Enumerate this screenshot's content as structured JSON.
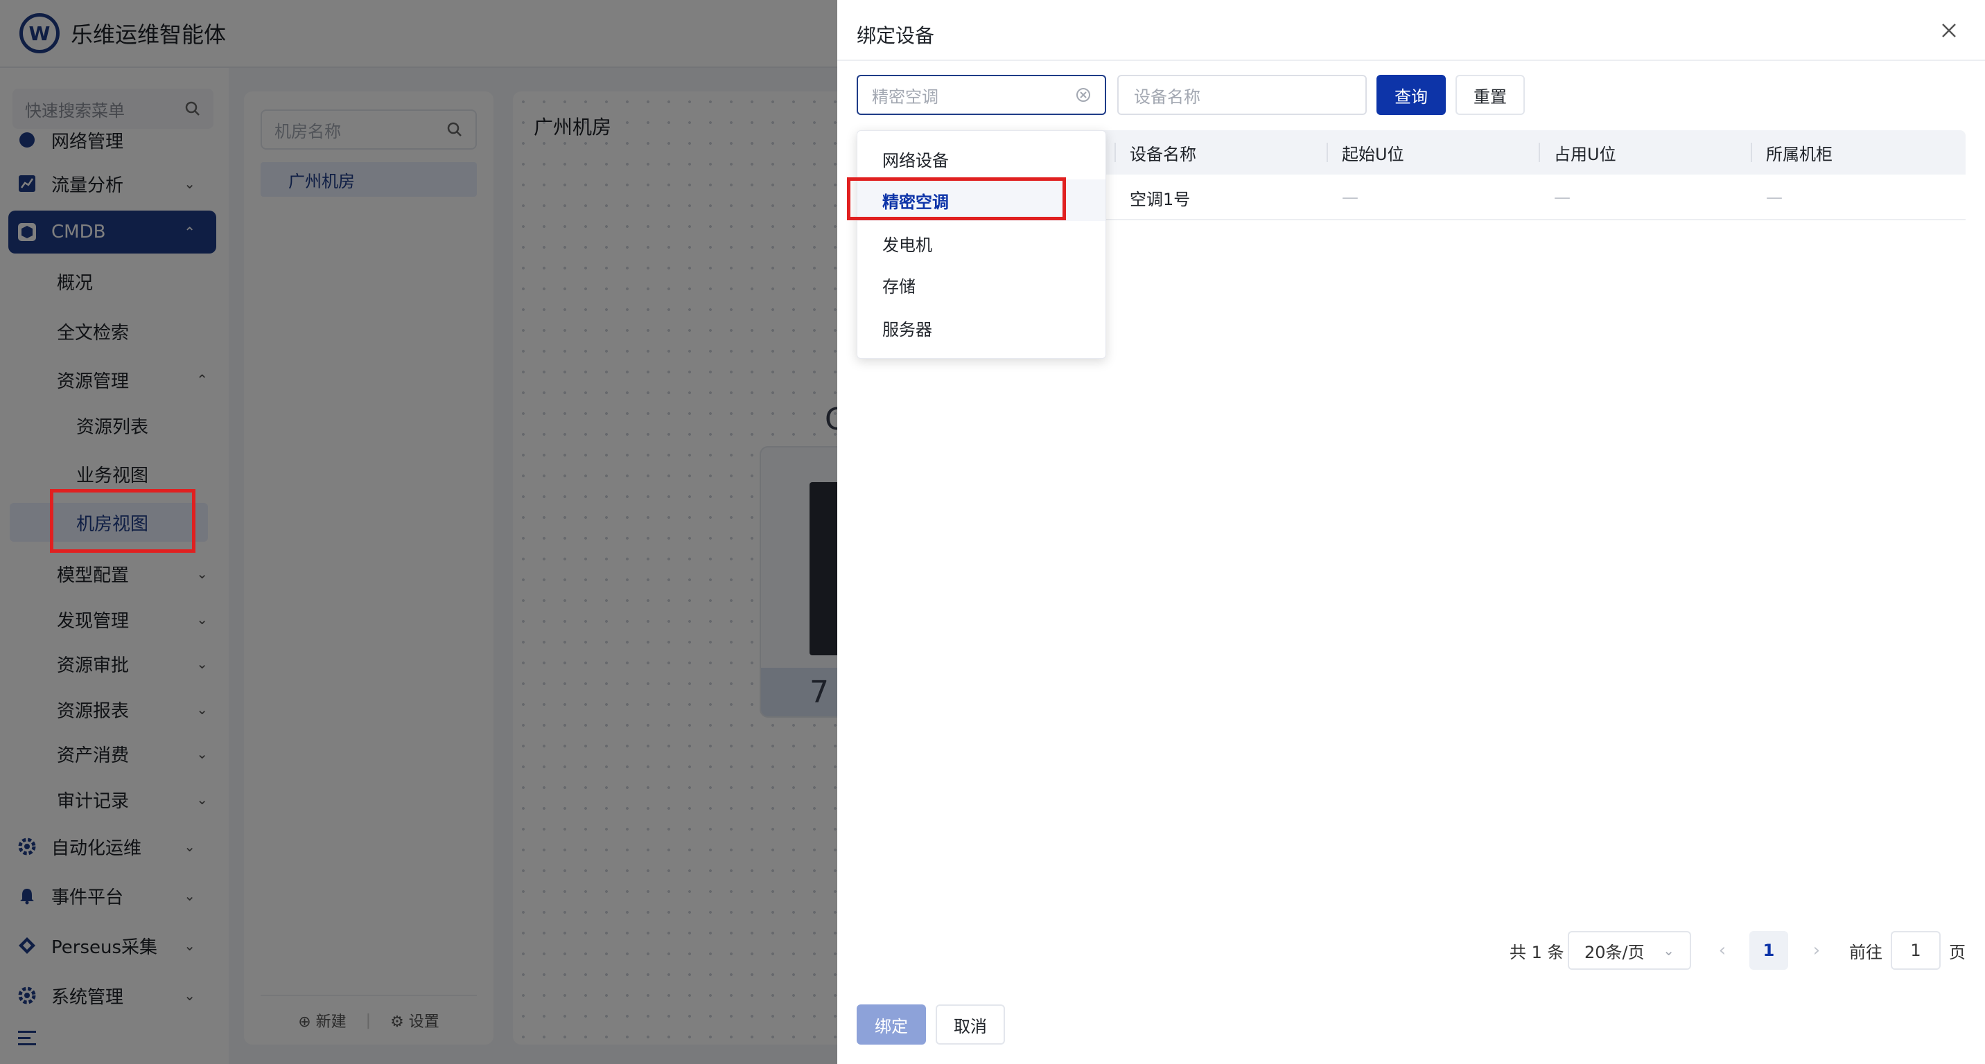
{
  "app": {
    "title": "乐维运维智能体",
    "logo_letter": "W"
  },
  "sidebar": {
    "search_placeholder": "快速搜索菜单",
    "partial_top_label": "网络管理",
    "items": [
      {
        "label": "流量分析"
      },
      {
        "label": "CMDB"
      },
      {
        "label": "自动化运维"
      },
      {
        "label": "事件平台"
      },
      {
        "label": "Perseus采集"
      },
      {
        "label": "系统管理"
      }
    ],
    "cmdb_children": [
      {
        "label": "概况"
      },
      {
        "label": "全文检索"
      },
      {
        "label": "资源管理"
      },
      {
        "label": "模型配置"
      },
      {
        "label": "发现管理"
      },
      {
        "label": "资源审批"
      },
      {
        "label": "资源报表"
      },
      {
        "label": "资产消费"
      },
      {
        "label": "审计记录"
      }
    ],
    "resource_children": [
      {
        "label": "资源列表"
      },
      {
        "label": "业务视图"
      },
      {
        "label": "机房视图"
      }
    ],
    "menu_toggle_icon": "menu-fold-icon"
  },
  "room_panel": {
    "search_placeholder": "机房名称",
    "rooms": [
      "广州机房"
    ],
    "new_label": "新建",
    "settings_label": "设置"
  },
  "canvas": {
    "title": "广州机房",
    "cabinet_number_partial": "7",
    "side_letter": "C"
  },
  "drawer": {
    "title": "绑定设备",
    "type_select": {
      "placeholder": "精密空调"
    },
    "name_input": {
      "placeholder": "设备名称"
    },
    "query_label": "查询",
    "reset_label": "重置",
    "columns": [
      "设备名称",
      "起始U位",
      "占用U位",
      "所属机柜"
    ],
    "rows": [
      {
        "name": "空调1号",
        "start_u": "—",
        "used_u": "—",
        "cabinet": "—"
      }
    ],
    "dropdown_options": [
      "网络设备",
      "精密空调",
      "发电机",
      "存储",
      "服务器"
    ],
    "dropdown_selected": "精密空调",
    "pagination": {
      "total": "共 1 条",
      "page_size": "20条/页",
      "current_page": "1",
      "goto_label": "前往",
      "goto_value": "1",
      "page_suffix": "页"
    },
    "bind_label": "绑定",
    "cancel_label": "取消"
  },
  "colors": {
    "primary": "#0d34a8",
    "sidebar_active": "#1f3c88",
    "highlight": "#e02020"
  }
}
